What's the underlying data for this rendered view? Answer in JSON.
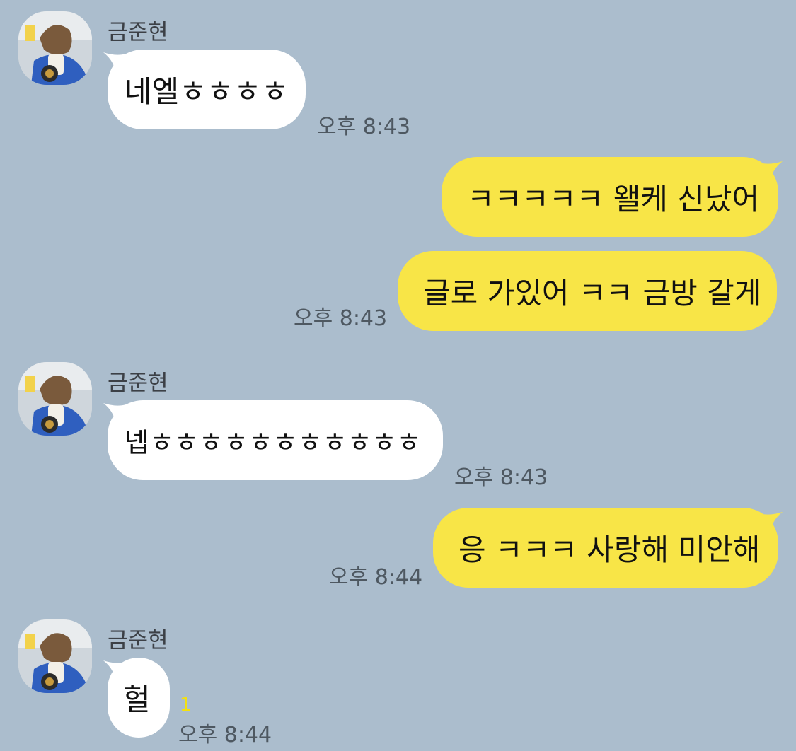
{
  "messages": [
    {
      "sender": "금준현",
      "text": "네엘ㅎㅎㅎㅎ",
      "time": "오후 8:43"
    },
    {
      "text": "ㅋㅋㅋㅋㅋ 왤케 신났어"
    },
    {
      "text": "글로 가있어 ㅋㅋ 금방 갈게",
      "time": "오후 8:43"
    },
    {
      "sender": "금준현",
      "text": "넵ㅎㅎㅎㅎㅎㅎㅎㅎㅎㅎㅎ",
      "time": "오후 8:43"
    },
    {
      "text": "응 ㅋㅋㅋ 사랑해 미안해",
      "time": "오후 8:44"
    },
    {
      "sender": "금준현",
      "text": "헐",
      "unread": "1",
      "time": "오후 8:44"
    }
  ],
  "colors": {
    "background": "#abbdcd",
    "incoming_bubble": "#ffffff",
    "outgoing_bubble": "#f8e547",
    "unread_count": "#f4e10c"
  },
  "icons": {
    "avatar": "profile-photo"
  }
}
